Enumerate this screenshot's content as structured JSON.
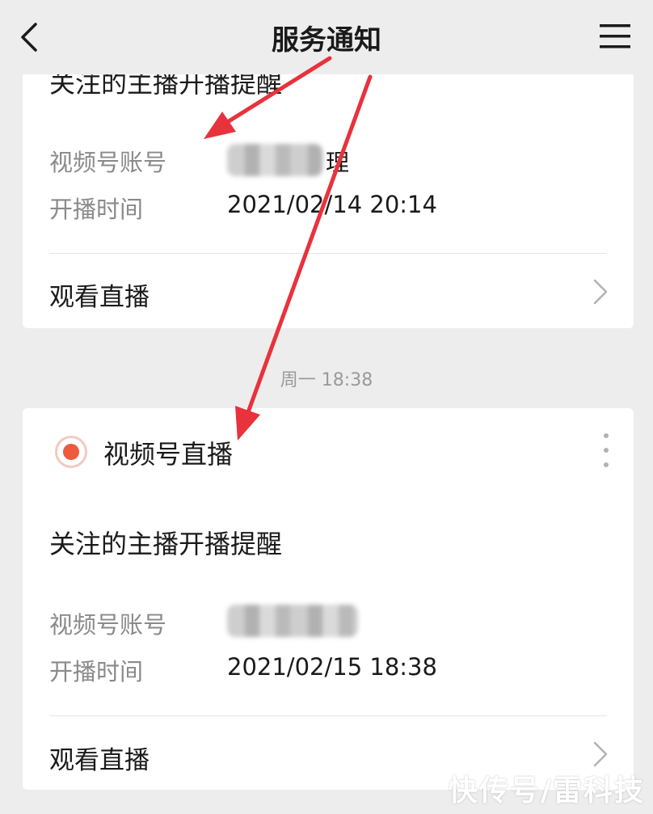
{
  "nav": {
    "title": "服务通知",
    "back_icon": "chevron-left-icon",
    "menu_icon": "hamburger-menu-icon"
  },
  "card1": {
    "heading": "关注的主播开播提醒",
    "account_label": "视频号账号",
    "account_value_visible": "理",
    "time_label": "开播时间",
    "time_value": "2021/02/14 20:14",
    "action_label": "观看直播"
  },
  "timestamp": "周一 18:38",
  "card2": {
    "brand_name": "视频号直播",
    "brand_icon": "live-dot-icon",
    "brand_color": "#ee5a3c",
    "more_icon": "more-vertical-icon",
    "heading": "关注的主播开播提醒",
    "account_label": "视频号账号",
    "time_label": "开播时间",
    "time_value": "2021/02/15 18:38",
    "action_label": "观看直播"
  },
  "annotation_color": "#e8323c",
  "watermark": "快传号/雷科技"
}
